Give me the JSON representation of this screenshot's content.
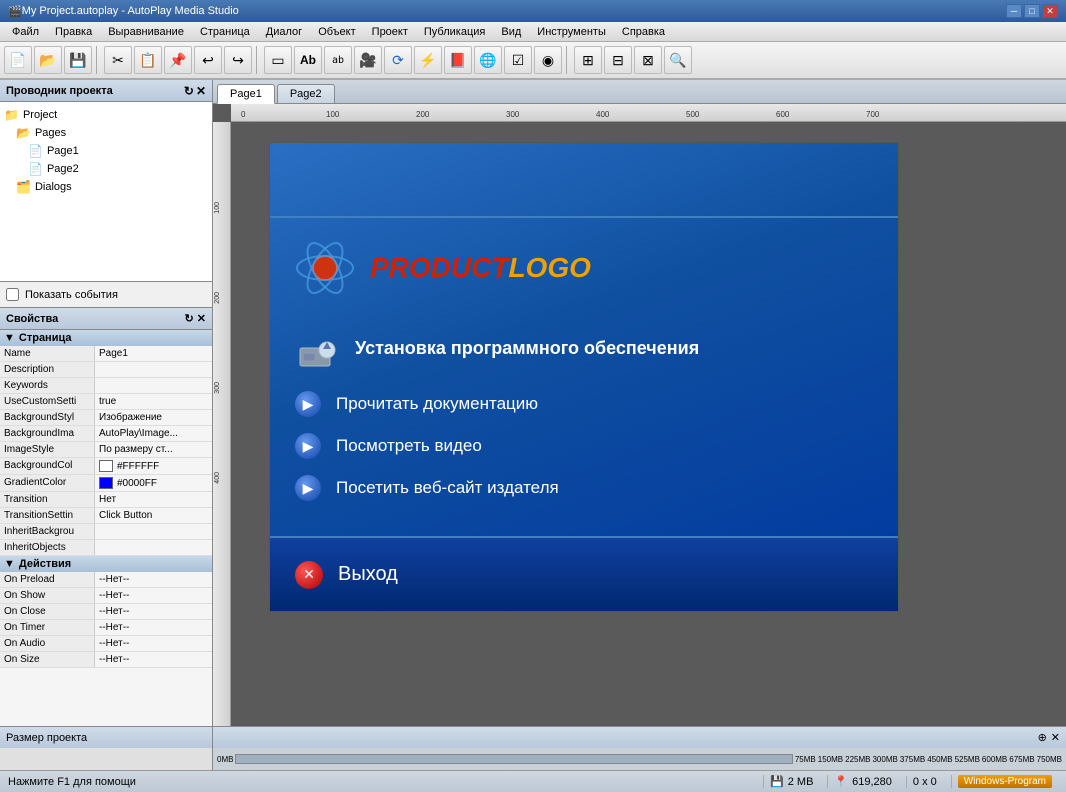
{
  "titlebar": {
    "title": "My Project.autoplay - AutoPlay Media Studio",
    "icon": "🎬"
  },
  "menubar": {
    "items": [
      "Файл",
      "Правка",
      "Выравнивание",
      "Страница",
      "Диалог",
      "Объект",
      "Проект",
      "Публикация",
      "Вид",
      "Инструменты",
      "Справка"
    ]
  },
  "project_nav": {
    "title": "Проводник проекта"
  },
  "project_tree": {
    "items": [
      {
        "label": "Project",
        "indent": 0,
        "icon": "📁"
      },
      {
        "label": "Pages",
        "indent": 1,
        "icon": "📂"
      },
      {
        "label": "Page1",
        "indent": 2,
        "icon": "📄"
      },
      {
        "label": "Page2",
        "indent": 2,
        "icon": "📄"
      },
      {
        "label": "Dialogs",
        "indent": 1,
        "icon": "🗂️"
      }
    ]
  },
  "show_events": "Показать события",
  "properties": {
    "title": "Свойства",
    "section_page": "Страница",
    "section_actions": "Действия",
    "rows": [
      {
        "name": "Name",
        "value": "Page1"
      },
      {
        "name": "Description",
        "value": ""
      },
      {
        "name": "Keywords",
        "value": ""
      },
      {
        "name": "UseCustomSetti",
        "value": "true"
      },
      {
        "name": "BackgroundStyl",
        "value": "Изображение"
      },
      {
        "name": "BackgroundIma",
        "value": "AutoPlay\\Image..."
      },
      {
        "name": "ImageStyle",
        "value": "По размеру ст..."
      },
      {
        "name": "BackgroundCol",
        "value": "#FFFFFF",
        "color": "#FFFFFF"
      },
      {
        "name": "GradientColor",
        "value": "#0000FF",
        "color": "#0000FF"
      },
      {
        "name": "Transition",
        "value": "Нет"
      },
      {
        "name": "TransitionSettin",
        "value": "Click Button"
      },
      {
        "name": "InheritBackgrou",
        "value": ""
      },
      {
        "name": "InheritObjects",
        "value": ""
      }
    ],
    "action_rows": [
      {
        "name": "On Preload",
        "value": "--Нет--"
      },
      {
        "name": "On Show",
        "value": "--Нет--"
      },
      {
        "name": "On Close",
        "value": "--Нет--"
      },
      {
        "name": "On Timer",
        "value": "--Нет--"
      },
      {
        "name": "On Audio",
        "value": "--Нет--"
      },
      {
        "name": "On Size",
        "value": "--Нет--"
      }
    ]
  },
  "tabs": [
    {
      "label": "Page1",
      "active": true
    },
    {
      "label": "Page2",
      "active": false
    }
  ],
  "canvas": {
    "page_content": {
      "logo_product": "PRODUCT",
      "logo_logo": "LOGO",
      "menu_items": [
        "Установка программного обеспечения",
        "Прочитать документацию",
        "Посмотреть видео",
        "Посетить веб-сайт издателя"
      ],
      "exit_text": "Выход"
    }
  },
  "ruler_top_marks": [
    "0",
    "100",
    "200",
    "300",
    "400",
    "500",
    "600",
    "700"
  ],
  "ruler_left_marks": [
    "100",
    "200",
    "300",
    "400"
  ],
  "size_panel_left": {
    "title": "Размер проекта"
  },
  "statusbar": {
    "help": "Нажмите F1 для помощи",
    "memory": "2 MB",
    "coordinates": "619,280",
    "size": "0 x 0",
    "taskbar_label": "Windows-Program"
  }
}
